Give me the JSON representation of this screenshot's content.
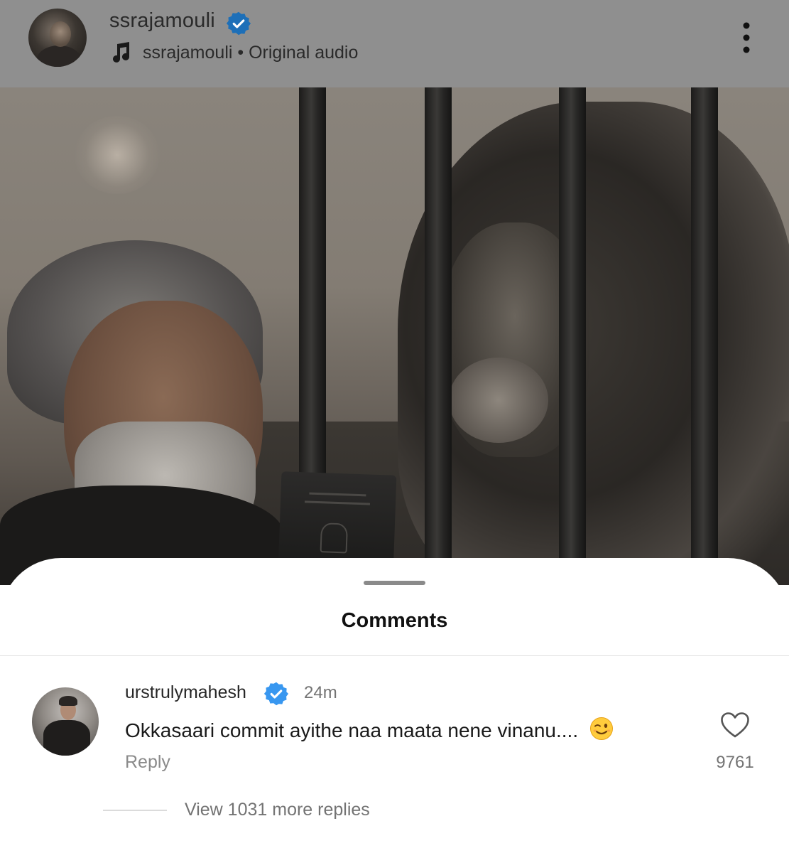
{
  "post": {
    "username": "ssrajamouli",
    "audio_user": "ssrajamouli",
    "separator": "•",
    "audio_label": "Original audio",
    "icons": {
      "verified": "verified-badge-icon",
      "music": "music-note-icon",
      "more": "more-options-icon"
    },
    "passport_text": "REPUBLIC OF INDIA"
  },
  "comments_sheet": {
    "title": "Comments",
    "comment": {
      "username": "urstrulymahesh",
      "time": "24m",
      "text": "Okkasaari commit ayithe naa maata nene vinanu....",
      "emoji": "wink-emoji-icon",
      "reply_label": "Reply",
      "like_count": "9761",
      "view_replies": "View 1031 more replies"
    }
  },
  "colors": {
    "header_bg": "#8f8f8f",
    "verified_blue": "#3897f0",
    "secondary_text": "#737373"
  }
}
